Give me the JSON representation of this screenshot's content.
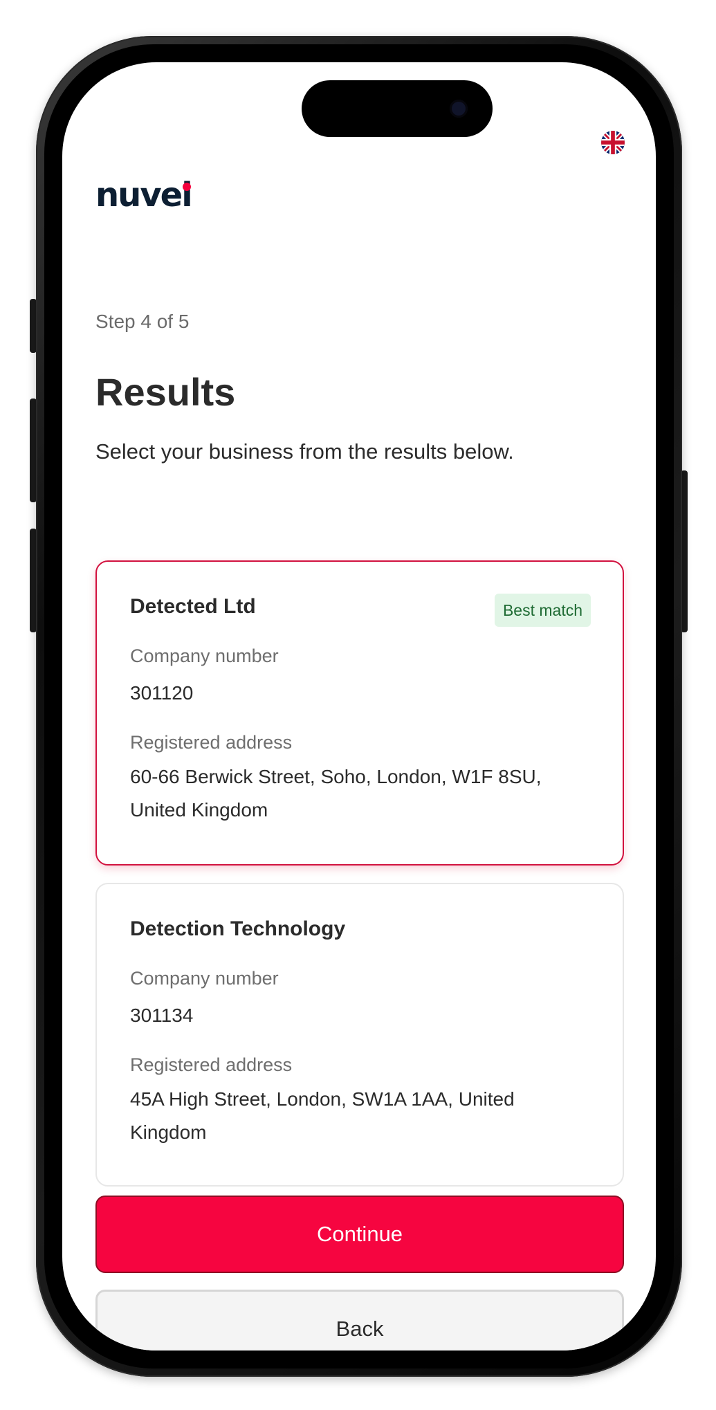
{
  "app": {
    "brand": "nuvei",
    "language_icon": "uk-flag-icon"
  },
  "header": {
    "step": "Step 4 of 5",
    "title": "Results",
    "subtitle": "Select your business from the results below."
  },
  "results": [
    {
      "name": "Detected Ltd",
      "badge": "Best match",
      "number_label": "Company number",
      "number": "301120",
      "address_label": "Registered address",
      "address": "60-66 Berwick Street, Soho, London, W1F 8SU, United Kingdom",
      "selected": true
    },
    {
      "name": "Detection Technology",
      "number_label": "Company number",
      "number": "301134",
      "address_label": "Registered address",
      "address": "45A High Street, London, SW1A 1AA, United Kingdom",
      "selected": false
    }
  ],
  "actions": {
    "continue_label": "Continue",
    "back_label": "Back"
  },
  "colors": {
    "accent": "#f60540",
    "selected_border": "#d2123f",
    "badge_bg": "#e1f5e6",
    "badge_text": "#1f6b34",
    "brand_text": "#0d1f33"
  }
}
